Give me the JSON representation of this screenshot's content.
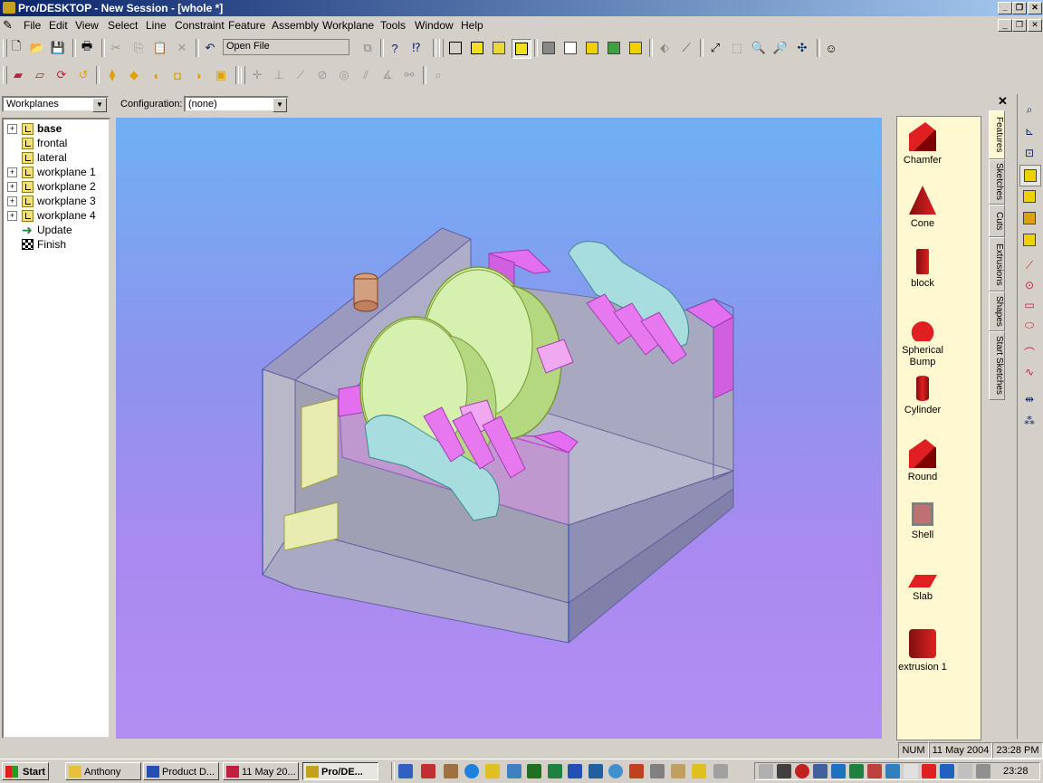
{
  "window": {
    "title": "Pro/DESKTOP - New Session - [whole *]"
  },
  "menu": [
    "File",
    "Edit",
    "View",
    "Select",
    "Line",
    "Constraint",
    "Feature",
    "Assembly",
    "Workplane",
    "Tools",
    "Window",
    "Help"
  ],
  "toolbar": {
    "open_file_label": "Open File"
  },
  "browser": {
    "selector": "Workplanes",
    "configuration_label": "Configuration:",
    "configuration_value": "(none)",
    "items": [
      {
        "label": "base",
        "expandable": true,
        "bold": true
      },
      {
        "label": "frontal",
        "expandable": false
      },
      {
        "label": "lateral",
        "expandable": false
      },
      {
        "label": "workplane 1",
        "expandable": true
      },
      {
        "label": "workplane 2",
        "expandable": true
      },
      {
        "label": "workplane 3",
        "expandable": true
      },
      {
        "label": "workplane 4",
        "expandable": true
      },
      {
        "label": "Update",
        "expandable": false
      },
      {
        "label": "Finish",
        "expandable": false
      }
    ]
  },
  "palette": {
    "features": [
      "Chamfer",
      "Cone",
      "block",
      "Spherical Bump",
      "Cylinder",
      "Round",
      "Shell",
      "Slab",
      "extrusion 1"
    ],
    "tabs": [
      "Features",
      "Sketches",
      "Cuts",
      "Extrusions",
      "Shapes",
      "Start Sketches"
    ]
  },
  "status": {
    "num": "NUM",
    "date": "11 May 2004",
    "time": "23:28 PM"
  },
  "taskbar": {
    "start": "Start",
    "tasks": [
      "Anthony",
      "Product D...",
      "11 May 20...",
      "Pro/DE..."
    ],
    "clock": "23:28"
  },
  "colors": {
    "title_start": "#0a246a",
    "title_end": "#a6caf0",
    "viewport_top": "#6fb0f4",
    "viewport_bottom": "#b28ef2",
    "face_gray": "#a9a9c6",
    "pink": "#e06ee8",
    "green": "#ccecaa",
    "cyan": "#a8dde0"
  }
}
